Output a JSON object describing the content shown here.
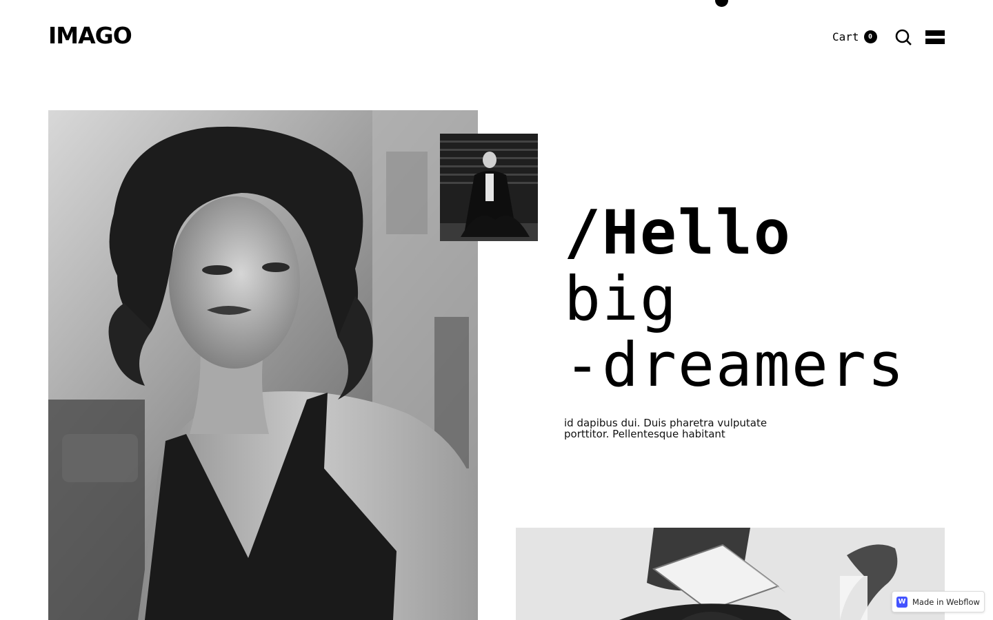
{
  "header": {
    "logo": "IMAGO",
    "cart_label": "Cart",
    "cart_count": "0",
    "search_icon": "search-icon",
    "menu_icon": "hamburger-menu-icon"
  },
  "hero": {
    "title_line1": "/Hello",
    "title_line2": "big",
    "title_line3": "-dreamers",
    "description": "id dapibus dui. Duis pharetra vulputate porttitor. Pellentesque habitant"
  },
  "badge": {
    "logo_letter": "W",
    "label": "Made in Webflow",
    "accent_color": "#4353ff"
  }
}
